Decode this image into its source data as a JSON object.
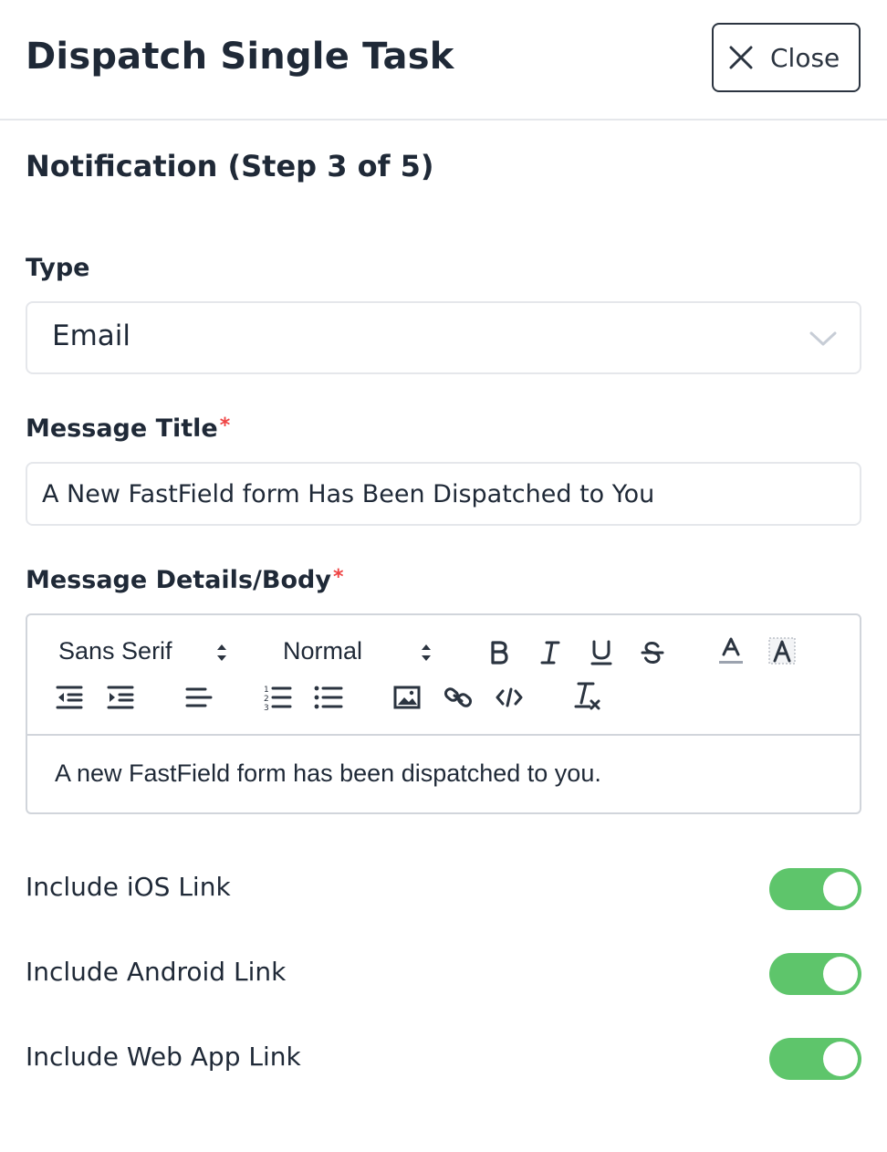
{
  "header": {
    "title": "Dispatch Single Task",
    "close_label": "Close"
  },
  "step_title": "Notification (Step 3 of 5)",
  "type_field": {
    "label": "Type",
    "value": "Email"
  },
  "message_title": {
    "label": "Message Title",
    "required_mark": "*",
    "value": "A New FastField form Has Been Dispatched to You"
  },
  "message_body": {
    "label": "Message Details/Body",
    "required_mark": "*",
    "toolbar": {
      "font": "Sans Serif",
      "size": "Normal"
    },
    "content": "A new FastField form has been dispatched to you."
  },
  "toggles": [
    {
      "label": "Include iOS Link",
      "on": true
    },
    {
      "label": "Include Android Link",
      "on": true
    },
    {
      "label": "Include Web App Link",
      "on": true
    }
  ],
  "colors": {
    "toggle_on": "#5ec56b",
    "required": "#ef4444",
    "text": "#1f2937"
  }
}
